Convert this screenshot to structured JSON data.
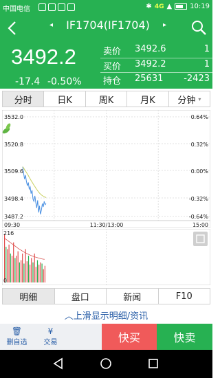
{
  "status_bar": {
    "carrier": "中国电信",
    "network": "4G",
    "time": "10:19"
  },
  "header": {
    "title": "IF1704(IF1704)",
    "prev_arrow": "◂",
    "next_arrow": "▸"
  },
  "quote": {
    "price": "3492.2",
    "change": "-17.4",
    "change_pct": "-0.50%",
    "rows": [
      {
        "label": "卖价",
        "value": "3492.6",
        "qty": "1"
      },
      {
        "label": "买价",
        "value": "3492.2",
        "qty": "1"
      },
      {
        "label": "持仓",
        "value": "25631",
        "qty": "-2423"
      }
    ]
  },
  "period_tabs": [
    {
      "label": "分时",
      "active": true
    },
    {
      "label": "日K",
      "active": false
    },
    {
      "label": "周K",
      "active": false
    },
    {
      "label": "月K",
      "active": false
    },
    {
      "label": "分钟",
      "active": false
    }
  ],
  "chart": {
    "y_labels": [
      "3532.0",
      "3520.8",
      "3509.6",
      "3498.4",
      "3487.2"
    ],
    "pct_labels": [
      "0.64%",
      "0.32%",
      "0.00%",
      "-0.32%",
      "-0.64%"
    ],
    "x_labels": [
      "09:30",
      "11:30/13:00",
      "15:00"
    ]
  },
  "chart_data": {
    "type": "line",
    "title": "",
    "xlabel": "",
    "ylabel": "",
    "ylim": [
      3487.2,
      3532.0
    ],
    "x_ticks": [
      "09:30",
      "11:30/13:00",
      "15:00"
    ],
    "y_ticks": [
      3532.0,
      3520.8,
      3509.6,
      3498.4,
      3487.2
    ],
    "series": [
      {
        "values": [
          3509.6,
          3506.5,
          3504.0,
          3505.8,
          3503.0,
          3501.0,
          3502.5,
          3499.5,
          3500.5,
          3497.5,
          3499.0,
          3495.0,
          3494.0,
          3496.5,
          3493.5,
          3491.0,
          3494.5,
          3489.0,
          3492.0,
          3488.2,
          3490.0,
          3493.0,
          3491.5,
          3494.0,
          3492.5,
          3493.0
        ]
      },
      {
        "values": [
          3509.6,
          3509.0,
          3508.3,
          3507.7,
          3507.0,
          3506.3,
          3505.6,
          3504.8,
          3504.1,
          3503.4,
          3502.7,
          3502.0,
          3501.3,
          3500.7,
          3500.0,
          3499.4,
          3498.8,
          3498.2,
          3497.7,
          3497.3,
          3496.9,
          3496.6,
          3496.3,
          3496.1,
          3495.9,
          3495.7
        ]
      }
    ],
    "volume": {
      "max_label": "216",
      "min_label": "0",
      "values": [
        216,
        160,
        150,
        170,
        130,
        120,
        180,
        110,
        120,
        140,
        90,
        100,
        130,
        85,
        150,
        95,
        120,
        80,
        110,
        90,
        130,
        70,
        100,
        80,
        90,
        85,
        60,
        75
      ]
    },
    "volume_trend": [
      200,
      195,
      190,
      185,
      180,
      175,
      170,
      165,
      160,
      155,
      150,
      146,
      142,
      138,
      134,
      130,
      127,
      124,
      121,
      118,
      116,
      114,
      112,
      110,
      108,
      106,
      105,
      104
    ]
  },
  "bottom_tabs": [
    {
      "label": "明细",
      "active": true
    },
    {
      "label": "盘口",
      "active": false
    },
    {
      "label": "新闻",
      "active": false
    },
    {
      "label": "F10",
      "active": false
    }
  ],
  "slide_hint": "︿上滑显示明细/资讯",
  "actions": {
    "delete_watch": "删自选",
    "trade": "交易",
    "trade_icon": "¥",
    "buy": "快买",
    "sell": "快卖"
  },
  "colors": {
    "brand_green": "#27b152",
    "buy_red": "#f05a5a",
    "link_blue": "#2a5fa8",
    "price_line": "#4a90e2",
    "avg_line": "#c8d060"
  }
}
